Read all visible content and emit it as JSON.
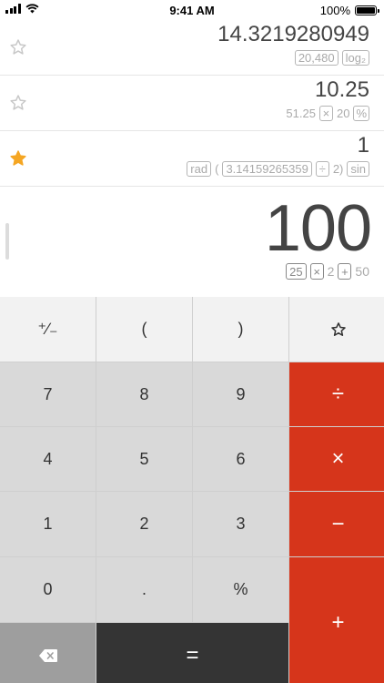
{
  "status_bar": {
    "time": "9:41 AM",
    "battery_percent": "100%",
    "battery_level": 1.0,
    "signal_icon": "cellular-signal-icon",
    "wifi_icon": "wifi-icon"
  },
  "history": [
    {
      "result": "14.3219280949",
      "favorite": false,
      "expression": [
        {
          "type": "box",
          "text": "20,480"
        },
        {
          "type": "box",
          "text": "log₂"
        }
      ]
    },
    {
      "result": "10.25",
      "favorite": false,
      "expression": [
        {
          "type": "text",
          "text": "51.25"
        },
        {
          "type": "op",
          "text": "×"
        },
        {
          "type": "text",
          "text": "20"
        },
        {
          "type": "op",
          "text": "%"
        }
      ]
    },
    {
      "result": "1",
      "favorite": true,
      "expression": [
        {
          "type": "box",
          "text": "rad"
        },
        {
          "type": "text",
          "text": "("
        },
        {
          "type": "box",
          "text": "3.14159265359"
        },
        {
          "type": "op",
          "text": "÷"
        },
        {
          "type": "text",
          "text": "2)"
        },
        {
          "type": "box",
          "text": "sin"
        }
      ]
    }
  ],
  "current": {
    "value": "100",
    "expression": [
      {
        "type": "box",
        "text": "25"
      },
      {
        "type": "op",
        "text": "×"
      },
      {
        "type": "text",
        "text": "2"
      },
      {
        "type": "op",
        "text": "+"
      },
      {
        "type": "text",
        "text": "50"
      }
    ]
  },
  "keypad": {
    "negate": "⁺∕₋",
    "open_paren": "(",
    "close_paren": ")",
    "favorite_icon": "star-outline-icon",
    "seven": "7",
    "eight": "8",
    "nine": "9",
    "divide": "÷",
    "four": "4",
    "five": "5",
    "six": "6",
    "multiply": "×",
    "one": "1",
    "two": "2",
    "three": "3",
    "minus": "−",
    "zero": "0",
    "decimal": ".",
    "percent": "%",
    "plus": "+",
    "backspace_icon": "backspace-icon",
    "equals": "="
  },
  "colors": {
    "operator_key": "#d6351b",
    "equals_key": "#343434",
    "backspace_key": "#9e9e9e",
    "number_key": "#d9d9d9",
    "function_key": "#f2f2f2",
    "favorite_star": "#f5a623",
    "inactive_star": "#c8c8c8"
  }
}
